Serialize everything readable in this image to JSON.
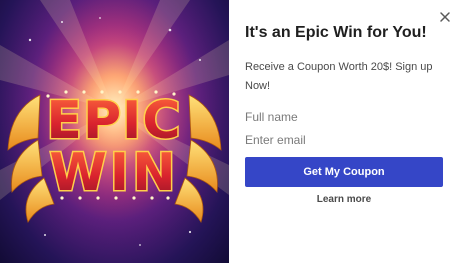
{
  "popup": {
    "hero": {
      "image_text": "EPIC WIN",
      "colors": {
        "background": "#2a1660",
        "glow": "#ffd27a",
        "letters": "#e23a2c",
        "letter_outline": "#ffcf4a"
      }
    },
    "close_icon": "close-icon",
    "title": "It's an Epic Win for You!",
    "subtitle": "Receive a Coupon Worth 20$! Sign up Now!",
    "form": {
      "name_placeholder": "Full name",
      "email_placeholder": "Enter email",
      "submit_label": "Get My Coupon"
    },
    "learn_more": "Learn more",
    "accent_color": "#3546c7"
  }
}
